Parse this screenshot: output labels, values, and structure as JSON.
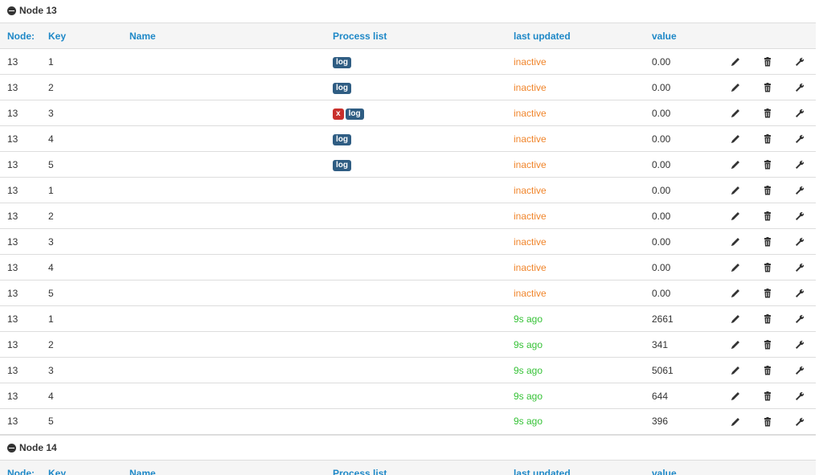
{
  "columns": [
    "Node:",
    "Key",
    "Name",
    "Process list",
    "last updated",
    "value"
  ],
  "nodes": [
    {
      "title": "Node 13",
      "rows": [
        {
          "node": "13",
          "key": "1",
          "name": "",
          "process": [
            "log"
          ],
          "status": "inactive",
          "state": "inactive",
          "value": "0.00"
        },
        {
          "node": "13",
          "key": "2",
          "name": "",
          "process": [
            "log"
          ],
          "status": "inactive",
          "state": "inactive",
          "value": "0.00"
        },
        {
          "node": "13",
          "key": "3",
          "name": "",
          "process": [
            "x",
            "log"
          ],
          "status": "inactive",
          "state": "inactive",
          "value": "0.00"
        },
        {
          "node": "13",
          "key": "4",
          "name": "",
          "process": [
            "log"
          ],
          "status": "inactive",
          "state": "inactive",
          "value": "0.00"
        },
        {
          "node": "13",
          "key": "5",
          "name": "",
          "process": [
            "log"
          ],
          "status": "inactive",
          "state": "inactive",
          "value": "0.00"
        },
        {
          "node": "13",
          "key": "1",
          "name": "",
          "process": [],
          "status": "inactive",
          "state": "inactive",
          "value": "0.00"
        },
        {
          "node": "13",
          "key": "2",
          "name": "",
          "process": [],
          "status": "inactive",
          "state": "inactive",
          "value": "0.00"
        },
        {
          "node": "13",
          "key": "3",
          "name": "",
          "process": [],
          "status": "inactive",
          "state": "inactive",
          "value": "0.00"
        },
        {
          "node": "13",
          "key": "4",
          "name": "",
          "process": [],
          "status": "inactive",
          "state": "inactive",
          "value": "0.00"
        },
        {
          "node": "13",
          "key": "5",
          "name": "",
          "process": [],
          "status": "inactive",
          "state": "inactive",
          "value": "0.00"
        },
        {
          "node": "13",
          "key": "1",
          "name": "",
          "process": [],
          "status": "9s ago",
          "state": "active",
          "value": "2661"
        },
        {
          "node": "13",
          "key": "2",
          "name": "",
          "process": [],
          "status": "9s ago",
          "state": "active",
          "value": "341"
        },
        {
          "node": "13",
          "key": "3",
          "name": "",
          "process": [],
          "status": "9s ago",
          "state": "active",
          "value": "5061"
        },
        {
          "node": "13",
          "key": "4",
          "name": "",
          "process": [],
          "status": "9s ago",
          "state": "active",
          "value": "644"
        },
        {
          "node": "13",
          "key": "5",
          "name": "",
          "process": [],
          "status": "9s ago",
          "state": "active",
          "value": "396"
        }
      ]
    },
    {
      "title": "Node 14",
      "rows": []
    }
  ],
  "row_actions": [
    "pencil-icon",
    "trash-icon",
    "wrench-icon"
  ],
  "colors": {
    "header_text": "#1e88c7",
    "inactive": "#f0852b",
    "active": "#36c237",
    "log_badge": "#2f5d83",
    "x_badge": "#c9302c"
  }
}
